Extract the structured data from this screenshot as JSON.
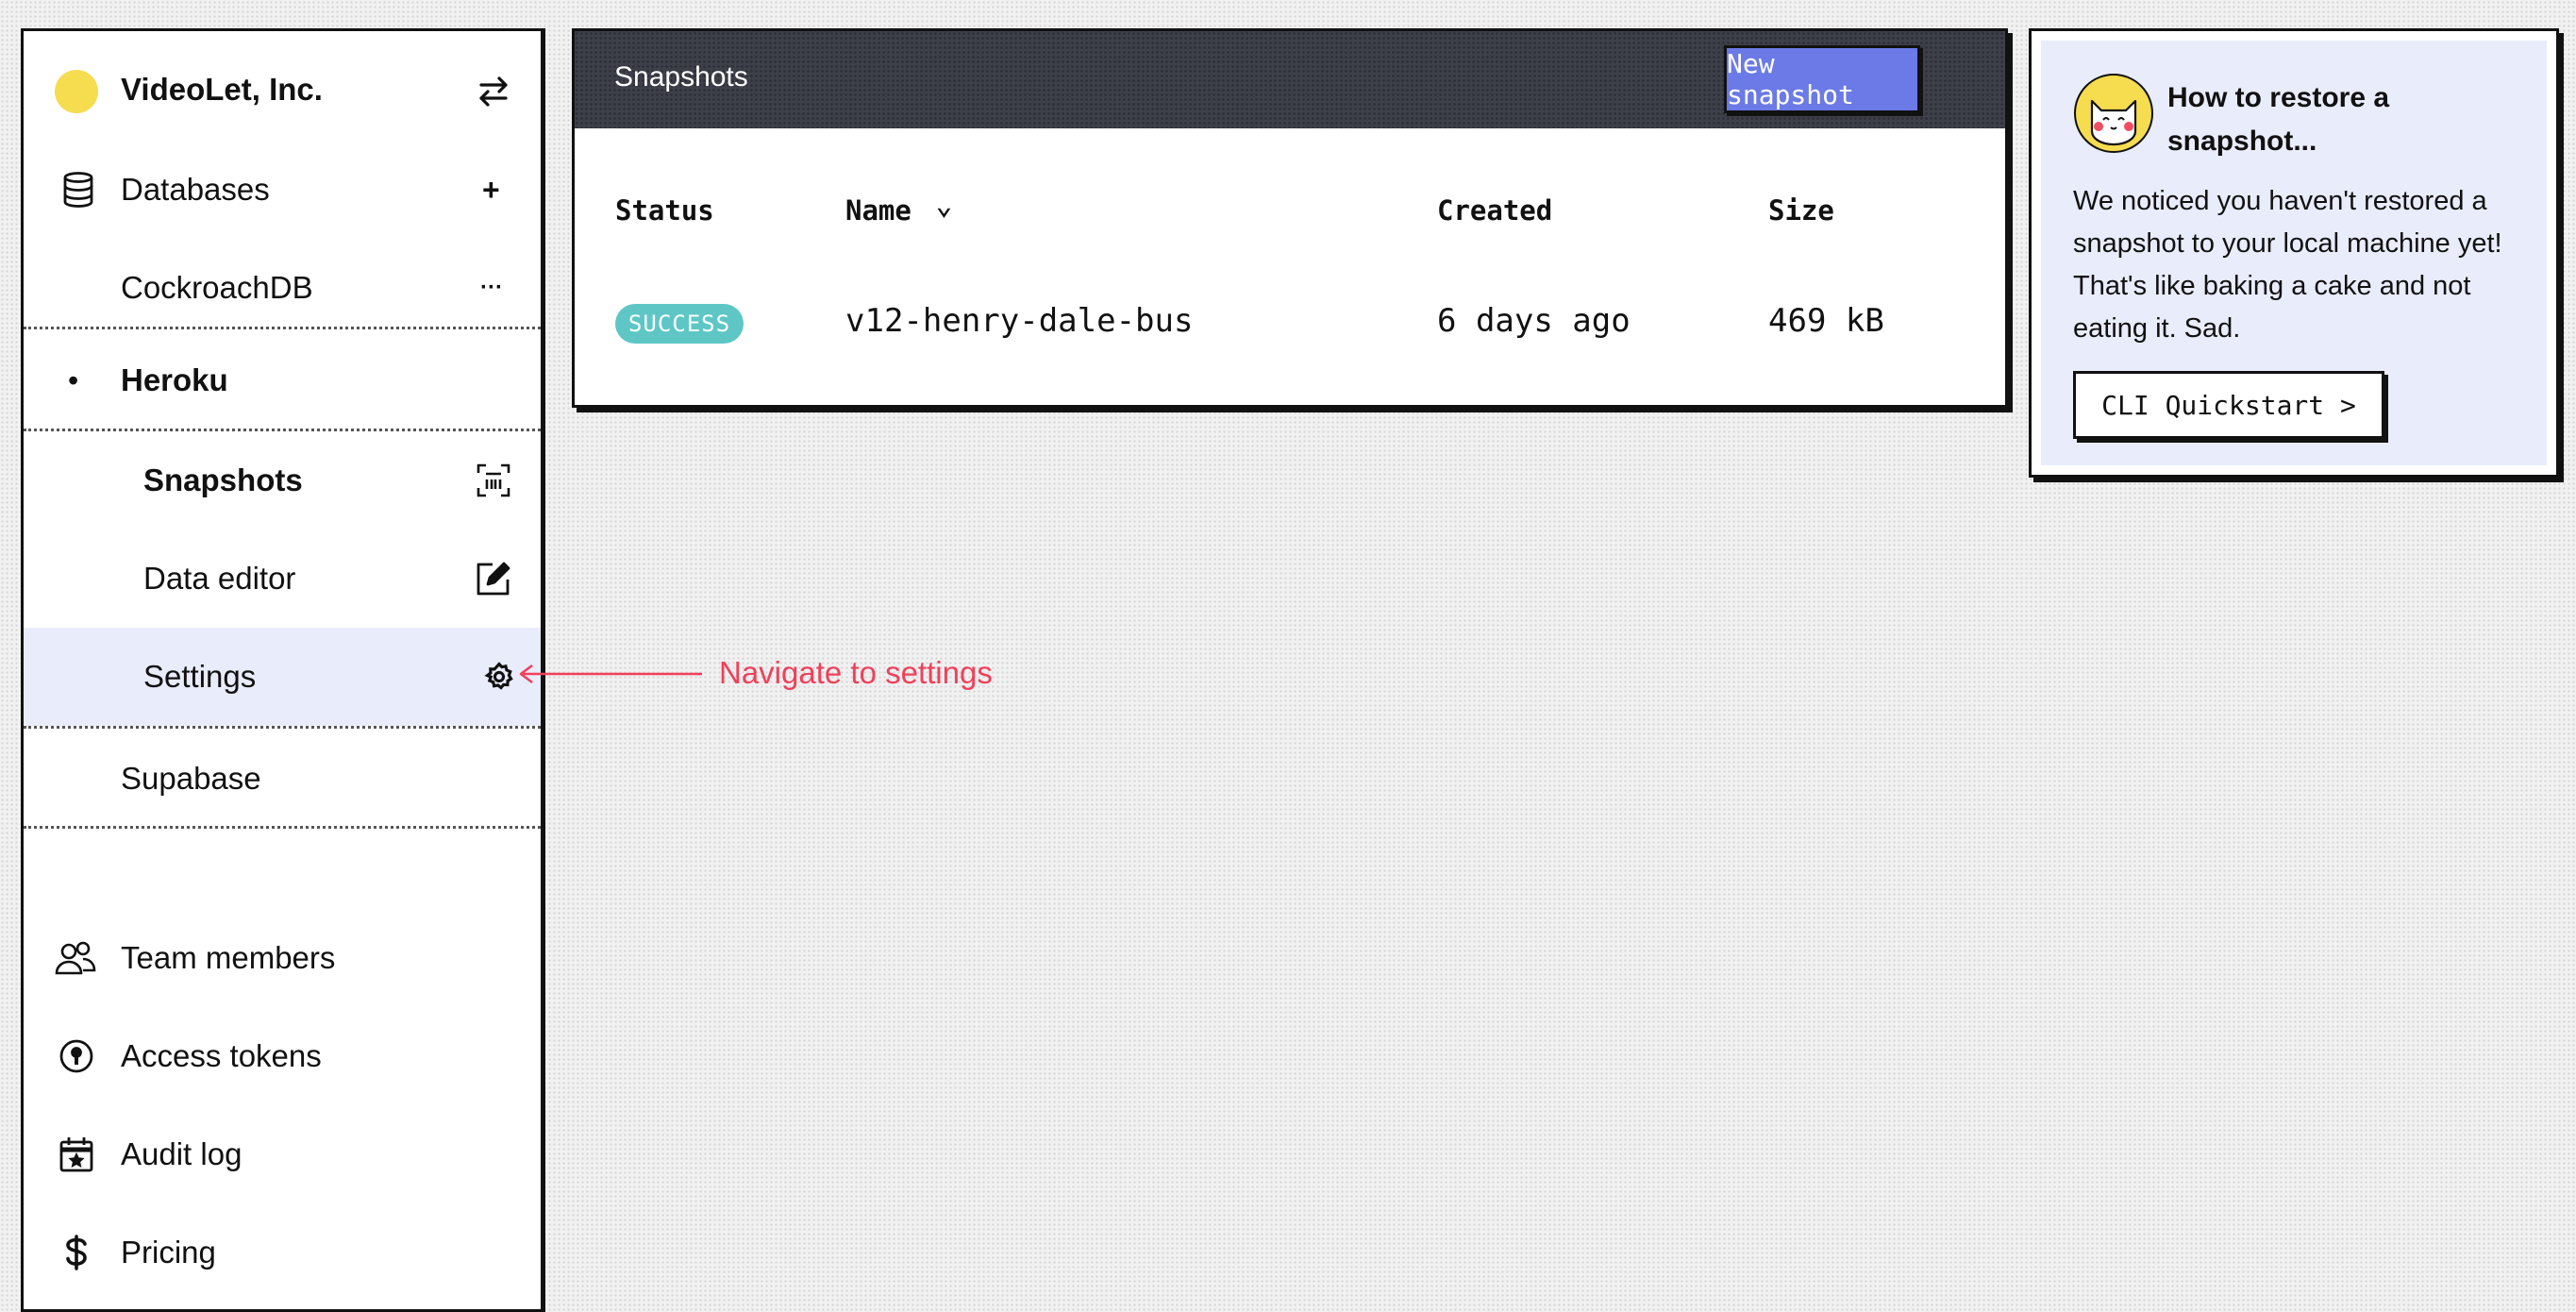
{
  "org": {
    "name": "VideoLet, Inc.",
    "avatar_color": "#f6dc4f",
    "icon": "switch-arrows-icon"
  },
  "sidebar": {
    "databases": {
      "label": "Databases",
      "icon": "database-icon",
      "action": "+"
    },
    "items": [
      {
        "label": "CockroachDB",
        "action": "···"
      },
      {
        "label": "Heroku",
        "bullet": "•"
      },
      {
        "label": "Supabase"
      }
    ],
    "heroku_children": [
      {
        "label": "Snapshots",
        "icon": "snapshot-icon"
      },
      {
        "label": "Data editor",
        "icon": "edit-icon"
      },
      {
        "label": "Settings",
        "icon": "gear-icon"
      }
    ],
    "bottom": [
      {
        "label": "Team members",
        "icon": "team-icon"
      },
      {
        "label": "Access tokens",
        "icon": "keyhole-icon"
      },
      {
        "label": "Audit log",
        "icon": "calendar-star-icon"
      },
      {
        "label": "Pricing",
        "icon": "dollar-icon"
      }
    ]
  },
  "snapshots": {
    "title": "Snapshots",
    "new_button": "New snapshot",
    "columns": [
      "Status",
      "Name",
      "Created",
      "Size"
    ],
    "sort_indicator": "⌄",
    "rows": [
      {
        "status": "SUCCESS",
        "name": "v12-henry-dale-bus",
        "created": "6 days ago",
        "size": "469 kB"
      }
    ]
  },
  "info_card": {
    "title": "How to restore a snapshot...",
    "body": "We noticed you haven't restored a snapshot to your local machine yet! That's like baking a cake and not eating it. Sad.",
    "button": "CLI Quickstart >"
  },
  "annotation": {
    "text": "Navigate to settings",
    "color": "#f0405a"
  },
  "colors": {
    "accent": "#6b7ae6",
    "success": "#5ec7c6",
    "selected_bg": "#e9ecfa",
    "header_bg": "#3d3f49"
  }
}
